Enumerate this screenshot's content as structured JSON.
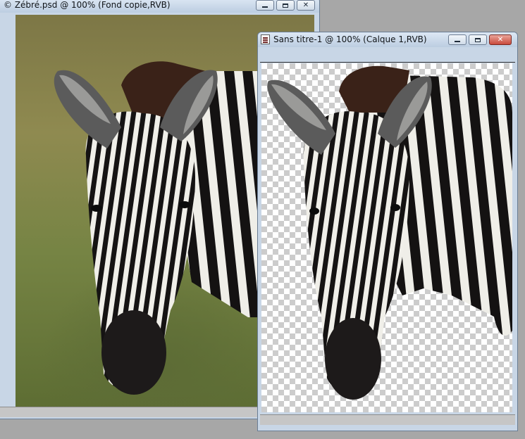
{
  "windows": {
    "back": {
      "title": "© Zébré.psd @ 100% (Fond copie,RVB)"
    },
    "front": {
      "title": "Sans titre-1 @ 100% (Calque  1,RVB)"
    }
  },
  "controls": {
    "minimize": "",
    "maximize": "",
    "close": "✕"
  },
  "colors": {
    "titlebar": "#c8d6e6",
    "close": "#c9493b",
    "transparency_grid": "#cccccc"
  },
  "icons": [
    "photoshop-document-icon",
    "minimize-icon",
    "maximize-icon",
    "close-icon"
  ]
}
